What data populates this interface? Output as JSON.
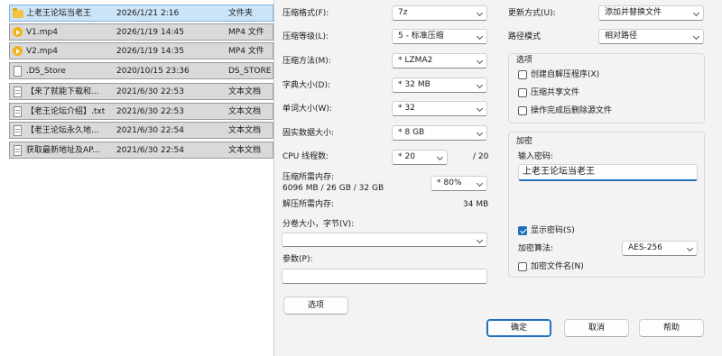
{
  "files": [
    {
      "name": "上老王论坛当老王",
      "date": "2026/1/21 2:16",
      "type": "文件夹",
      "icon": "folder-icon"
    },
    {
      "name": "V1.mp4",
      "date": "2026/1/19 14:45",
      "type": "MP4 文件",
      "icon": "video-file-icon"
    },
    {
      "name": "V2.mp4",
      "date": "2026/1/19 14:35",
      "type": "MP4 文件",
      "icon": "video-file-icon"
    },
    {
      "name": ".DS_Store",
      "date": "2020/10/15 23:36",
      "type": "DS_STORE",
      "icon": "file-icon"
    },
    {
      "name": "【来了就能下载和...",
      "date": "2021/6/30 22:53",
      "type": "文本文档",
      "icon": "text-file-icon"
    },
    {
      "name": "【老王论坛介绍】.txt",
      "date": "2021/6/30 22:53",
      "type": "文本文档",
      "icon": "text-file-icon"
    },
    {
      "name": "【老王论坛永久地...",
      "date": "2021/6/30 22:54",
      "type": "文本文档",
      "icon": "text-file-icon"
    },
    {
      "name": "获取最新地址及AP...",
      "date": "2021/6/30 22:54",
      "type": "文本文档",
      "icon": "text-file-icon"
    }
  ],
  "dialog": {
    "format_label": "压缩格式(F):",
    "format_value": "7z",
    "level_label": "压缩等级(L):",
    "level_value": "5 - 标准压缩",
    "method_label": "压缩方法(M):",
    "method_value": "LZMA2",
    "dict_label": "字典大小(D):",
    "dict_value": "32 MB",
    "word_label": "单词大小(W):",
    "word_value": "32",
    "solid_label": "固实数据大小:",
    "solid_value": "8 GB",
    "cpu_label": "CPU 线程数:",
    "cpu_value": "20",
    "cpu_max": "/ 20",
    "mem_label": "压缩所需内存:",
    "mem_detail": "6096 MB / 26 GB / 32 GB",
    "mem_value": "80%",
    "decomp_label": "解压所需内存:",
    "decomp_value": "34 MB",
    "volume_label": "分卷大小，字节(V):",
    "volume_value": "",
    "params_label": "参数(P):",
    "params_value": "",
    "options_button": "选项",
    "update_label": "更新方式(U):",
    "update_value": "添加并替换文件",
    "path_label": "路径模式",
    "path_value": "相对路径",
    "options_group": "选项",
    "sfx_label": "创建自解压程序(X)",
    "sfx_checked": false,
    "shared_label": "压缩共享文件",
    "shared_checked": false,
    "delete_label": "操作完成后删除源文件",
    "delete_checked": false,
    "encrypt_group": "加密",
    "password_label": "输入密码:",
    "password_value": "上老王论坛当老王",
    "show_pwd_label": "显示密码(S)",
    "show_pwd_checked": true,
    "algo_label": "加密算法:",
    "algo_value": "AES-256",
    "encrypt_names_label": "加密文件名(N)",
    "encrypt_names_checked": false,
    "ok_button": "确定",
    "cancel_button": "取消",
    "help_button": "帮助",
    "accent_color": "#1f6fc1"
  }
}
